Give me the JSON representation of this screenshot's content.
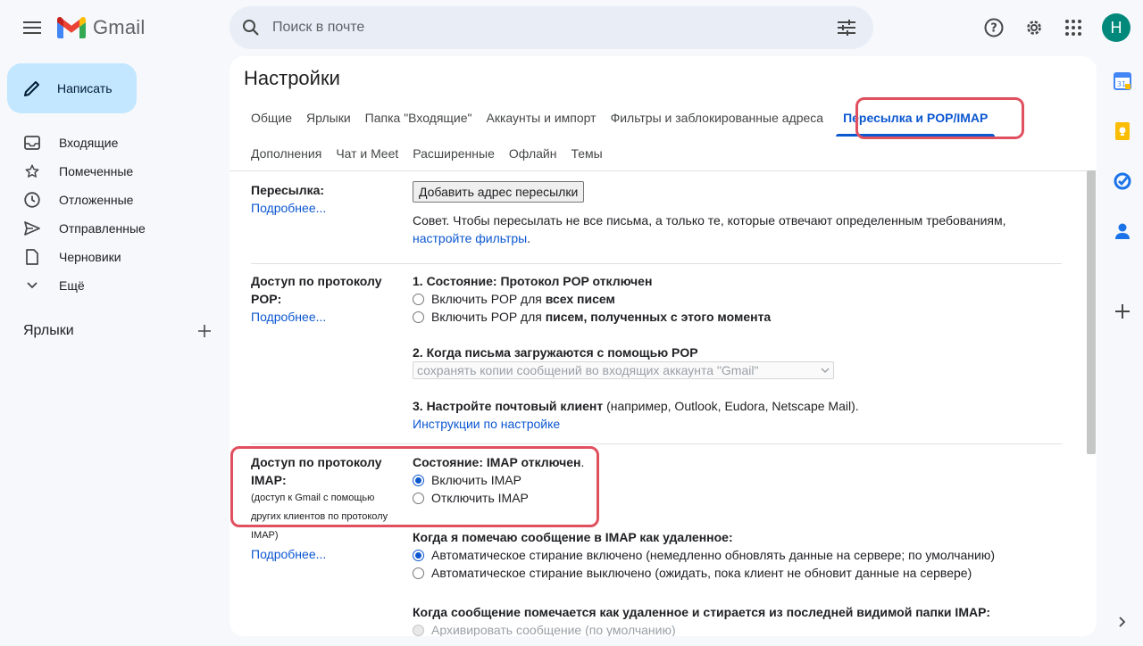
{
  "header": {
    "logo_text": "Gmail",
    "search_placeholder": "Поиск в почте",
    "avatar_letter": "Н"
  },
  "sidebar": {
    "compose_label": "Написать",
    "items": [
      {
        "label": "Входящие",
        "icon": "inbox-icon"
      },
      {
        "label": "Помеченные",
        "icon": "star-icon"
      },
      {
        "label": "Отложенные",
        "icon": "clock-icon"
      },
      {
        "label": "Отправленные",
        "icon": "send-icon"
      },
      {
        "label": "Черновики",
        "icon": "draft-icon"
      },
      {
        "label": "Ещё",
        "icon": "chevron-down-icon"
      }
    ],
    "labels_heading": "Ярлыки"
  },
  "settings": {
    "title": "Настройки",
    "tabs_row1": [
      "Общие",
      "Ярлыки",
      "Папка \"Входящие\"",
      "Аккаунты и импорт",
      "Фильтры и заблокированные адреса",
      "Пересылка и POP/IMAP"
    ],
    "tabs_row2": [
      "Дополнения",
      "Чат и Meet",
      "Расширенные",
      "Офлайн",
      "Темы"
    ],
    "active_tab": "Пересылка и POP/IMAP"
  },
  "forwarding": {
    "label": "Пересылка:",
    "more": "Подробнее...",
    "add_button": "Добавить адрес пересылки",
    "tip_text": "Совет. Чтобы пересылать не все письма, а только те, которые отвечают определенным требованиям,",
    "tip_link": "настройте фильтры",
    "tip_end": "."
  },
  "pop": {
    "label_line1": "Доступ по протоколу",
    "label_line2": "POP:",
    "more": "Подробнее...",
    "status": "1. Состояние: Протокол POP отключен",
    "opt1_prefix": "Включить POP для ",
    "opt1_bold": "всех писем",
    "opt2_prefix": "Включить POP для ",
    "opt2_bold": "писем, полученных с этого момента",
    "step2": "2. Когда письма загружаются с помощью POP",
    "select_value": "сохранять копии сообщений во входящих аккаунта \"Gmail\"",
    "step3_bold": "3. Настройте почтовый клиент",
    "step3_rest": " (например, Outlook, Eudora, Netscape Mail).",
    "instructions_link": "Инструкции по настройке"
  },
  "imap": {
    "label_line1": "Доступ по протоколу",
    "label_line2": "IMAP:",
    "label_small1": "(доступ к Gmail с помощью",
    "label_small2": "других клиентов по протоколу",
    "label_small3": "IMAP)",
    "more": "Подробнее...",
    "status_bold": "Состояние: IMAP отключен",
    "status_end": ".",
    "enable": "Включить IMAP",
    "disable": "Отключить IMAP",
    "deleted_heading": "Когда я помечаю сообщение в IMAP как удаленное:",
    "expunge_on": "Автоматическое стирание включено (немедленно обновлять данные на сервере; по умолчанию)",
    "expunge_off": "Автоматическое стирание выключено (ожидать, пока клиент не обновит данные на сервере)",
    "expunged_heading": "Когда сообщение помечается как удаленное и стирается из последней видимой папки IMAP:",
    "archive_option": "Архивировать сообщение (по умолчанию)"
  },
  "colors": {
    "accent": "#0b57d0",
    "highlight": "#e0505f",
    "compose_bg": "#c2e7ff",
    "avatar_bg": "#00897b"
  }
}
